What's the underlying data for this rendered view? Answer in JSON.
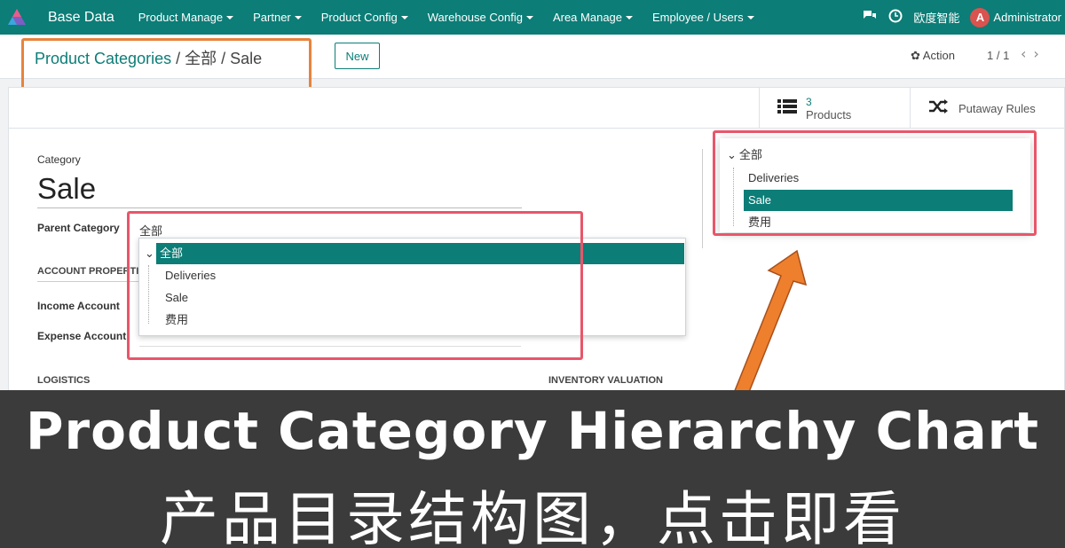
{
  "topbar": {
    "app_name": "Base Data",
    "menu": [
      {
        "label": "Product Manage"
      },
      {
        "label": "Partner"
      },
      {
        "label": "Product Config"
      },
      {
        "label": "Warehouse Config"
      },
      {
        "label": "Area Manage"
      },
      {
        "label": "Employee / Users"
      }
    ],
    "company": "欧度智能",
    "avatar_letter": "A",
    "user": "Administrator"
  },
  "control": {
    "breadcrumb_root": "Product Categories",
    "breadcrumb_sep": " / ",
    "breadcrumb_mid": "全部",
    "breadcrumb_current": "Sale",
    "new_label": "New",
    "action_label": "Action",
    "pager": "1 / 1"
  },
  "smart_buttons": {
    "products_count": "3",
    "products_label": "Products",
    "putaway_label": "Putaway Rules"
  },
  "form": {
    "category_label": "Category",
    "category_name": "Sale",
    "parent_label": "Parent Category",
    "parent_value": "全部",
    "account_section": "ACCOUNT PROPERTIES",
    "income_label": "Income Account",
    "expense_label": "Expense Account",
    "logistics_section": "LOGISTICS",
    "inventory_section": "INVENTORY VALUATION"
  },
  "dropdown": {
    "root": "全部",
    "children": [
      "Deliveries",
      "Sale",
      "费用"
    ]
  },
  "tree_panel": {
    "root": "全部",
    "children": [
      "Deliveries",
      "Sale",
      "费用"
    ],
    "selected": "Sale"
  },
  "banner": {
    "title_en": "Product Category Hierarchy Chart",
    "title_zh": "产品目录结构图，点击即看"
  },
  "colors": {
    "brand": "#0c7d77",
    "annotation_red": "#e8566a",
    "annotation_orange": "#e7833d"
  }
}
